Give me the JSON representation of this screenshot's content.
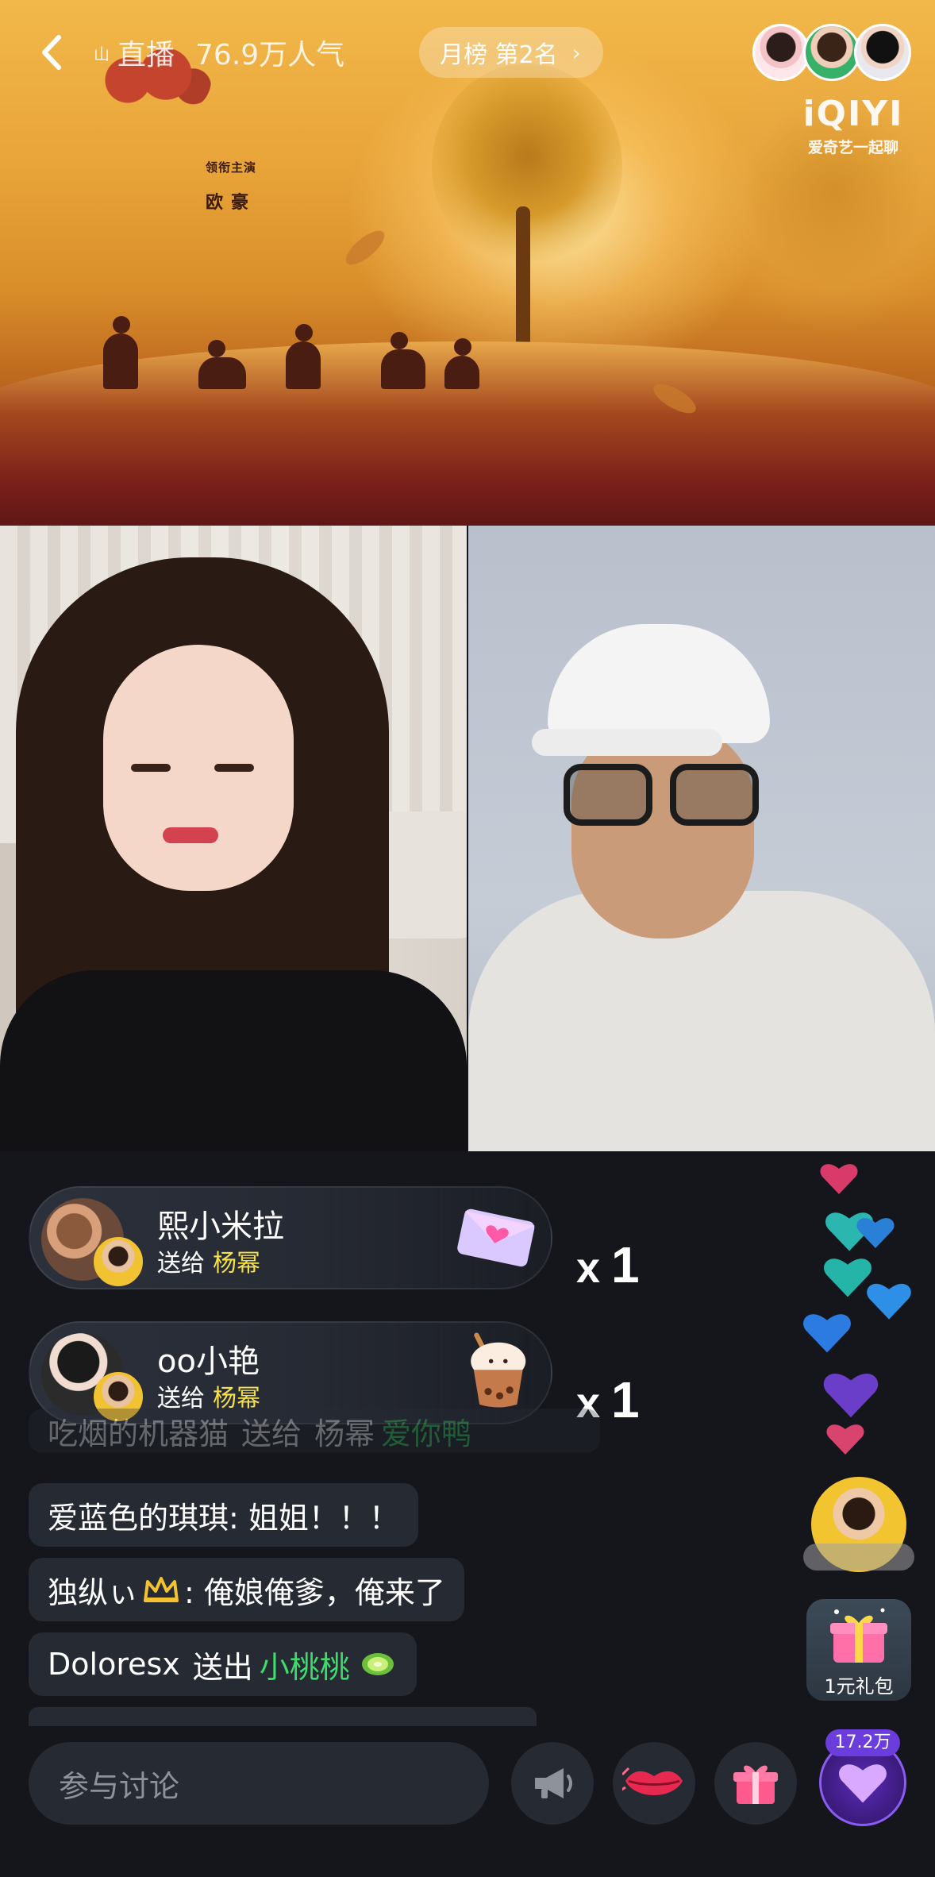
{
  "topbar": {
    "mini_label": "山",
    "live_label": "直播",
    "popularity": "76.9万人气",
    "rank_label": "月榜 第2名",
    "rank_chevron": "›",
    "back_icon": "chevron-left-icon",
    "brand_logo": "iQIYI",
    "brand_slogan": "爱奇艺一起聊"
  },
  "poster": {
    "credit_title": "领衔主演",
    "credit_name": "欧豪"
  },
  "gifts": [
    {
      "sender": "熙小米拉",
      "to_label": "送给",
      "target": "杨幂",
      "gift_icon": "love-letter-icon",
      "count_prefix": "x",
      "count": "1"
    },
    {
      "sender": "oo小艳",
      "to_label": "送给",
      "target": "杨幂",
      "gift_icon": "bubble-tea-icon",
      "count_prefix": "x",
      "count": "1"
    }
  ],
  "chat": {
    "faded_msg": {
      "user": "吃烟的机器猫",
      "verb": "送给",
      "target": "杨幂",
      "gift": "爱你鸭"
    },
    "messages": [
      {
        "user": "爱蓝色的琪琪",
        "text": ": 姐姐！！！"
      },
      {
        "user": "独纵ぃ",
        "badge": "crown-badge-icon",
        "text": ": 俺娘俺爹，俺来了"
      },
      {
        "user": "Doloresx",
        "verb": "送出",
        "gift": "小桃桃",
        "gift_icon": "kiwi-icon"
      }
    ]
  },
  "side": {
    "pack_label": "1元礼包",
    "pack_icon": "gift-box-icon",
    "like_count": "17.2万"
  },
  "bottom": {
    "input_placeholder": "参与讨论",
    "megaphone_icon": "megaphone-icon",
    "kiss_icon": "lips-icon",
    "gift_icon": "gift-icon",
    "like_icon": "heart-icon"
  },
  "colors": {
    "highlight_yellow": "#f5e04a",
    "highlight_green": "#3ddc6b",
    "like_purple": "#6b3ddc"
  }
}
